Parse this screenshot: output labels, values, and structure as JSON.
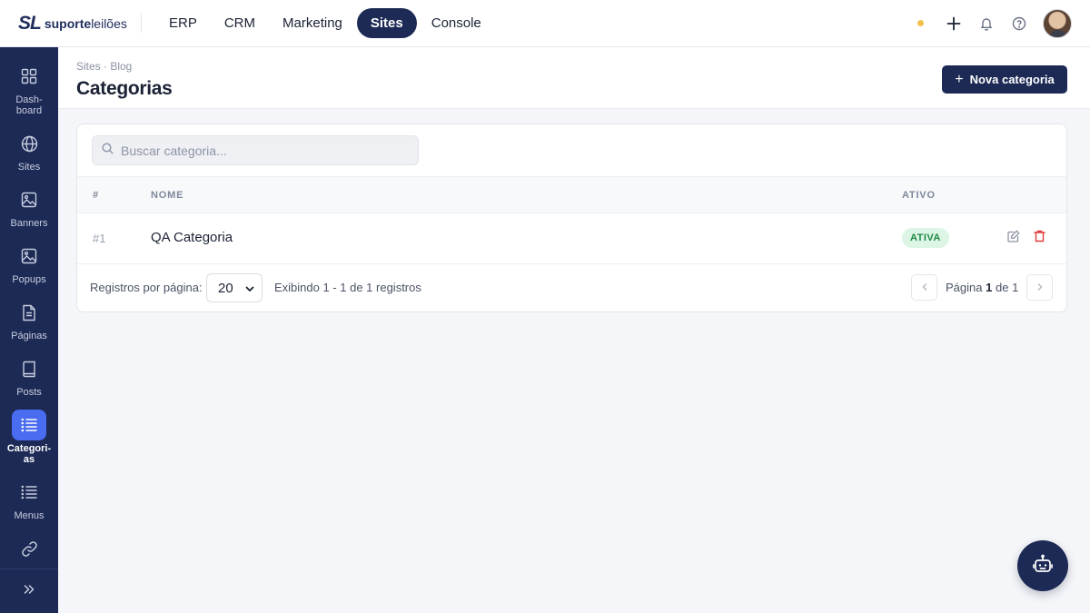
{
  "brand": {
    "mark": "SL",
    "name_bold": "suporte",
    "name_light": "leilões"
  },
  "topnav": {
    "items": [
      {
        "label": "ERP"
      },
      {
        "label": "CRM"
      },
      {
        "label": "Marketing"
      },
      {
        "label": "Sites",
        "active": true
      },
      {
        "label": "Console"
      }
    ]
  },
  "topbar_icons": [
    "plus-icon",
    "bell-icon",
    "help-icon"
  ],
  "sidebar": {
    "items": [
      {
        "label": "Dash-\nboard",
        "icon": "dashboard-icon"
      },
      {
        "label": "Sites",
        "icon": "globe-icon"
      },
      {
        "label": "Banners",
        "icon": "image-icon"
      },
      {
        "label": "Popups",
        "icon": "image-icon"
      },
      {
        "label": "Páginas",
        "icon": "document-icon"
      },
      {
        "label": "Posts",
        "icon": "book-icon"
      },
      {
        "label": "Categori-\nas",
        "icon": "list-icon",
        "active": true
      },
      {
        "label": "Menus",
        "icon": "list-icon"
      },
      {
        "label": "",
        "icon": "link-icon"
      }
    ],
    "expand_icon": "chevrons-right-icon"
  },
  "header": {
    "breadcrumb": "Sites · Blog",
    "title": "Categorias",
    "new_button": "Nova categoria"
  },
  "search": {
    "placeholder": "Buscar categoria..."
  },
  "table": {
    "columns": {
      "id": "#",
      "name": "NOME",
      "active": "ATIVO"
    },
    "rows": [
      {
        "id": "#1",
        "name": "QA Categoria",
        "status": "ATIVA"
      }
    ]
  },
  "footer": {
    "per_page_label": "Registros por página:",
    "per_page_value": "20",
    "showing": "Exibindo 1 - 1 de 1 registros",
    "page_label": "Página",
    "page_current": "1",
    "page_of": "de",
    "page_total": "1"
  },
  "colors": {
    "navy": "#1d2a55",
    "accent_blue": "#4a6cf0",
    "success_bg": "#dcf5e4",
    "success_text": "#1f8a46",
    "danger": "#e03a3a",
    "status_dot": "#f5c04a"
  }
}
